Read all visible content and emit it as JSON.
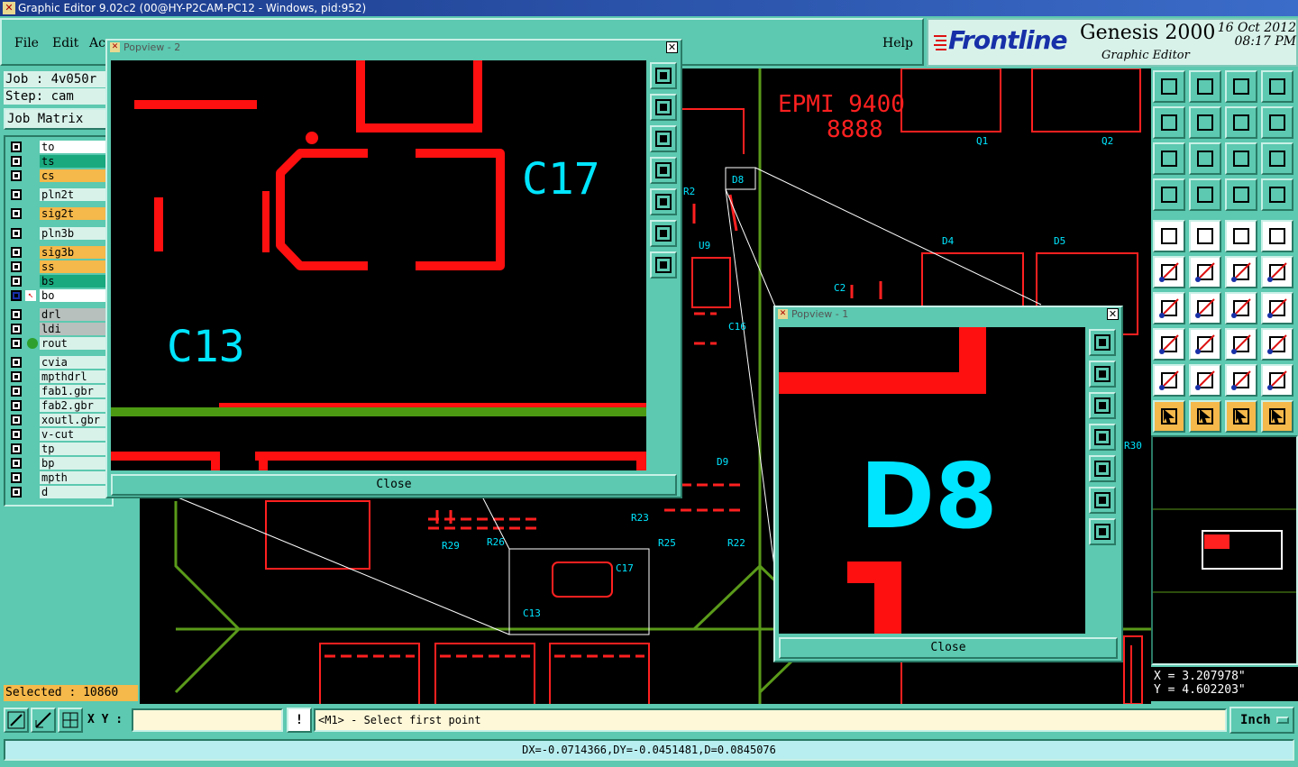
{
  "window": {
    "title": "Graphic Editor 9.02c2 (00@HY-P2CAM-PC12 - Windows, pid:952)"
  },
  "menu": {
    "file": "File",
    "edit": "Edit",
    "action": "Ac",
    "help": "Help"
  },
  "brand": {
    "logo": "Frontline",
    "product": "Genesis 2000",
    "module": "Graphic Editor",
    "date": "16 Oct 2012",
    "time": "08:17 PM"
  },
  "job": {
    "job": "Job : 4v050r",
    "step": "Step: cam",
    "matrix_button": "Job Matrix ..."
  },
  "layers": [
    {
      "name": "to",
      "color": "#ffffff"
    },
    {
      "name": "ts",
      "color": "#1aa97e"
    },
    {
      "name": "cs",
      "color": "#f5b84a"
    },
    {
      "name": "pln2t",
      "color": "#d8f2ea"
    },
    {
      "name": "sig2t",
      "color": "#f5b84a"
    },
    {
      "name": "pln3b",
      "color": "#d8f2ea"
    },
    {
      "name": "sig3b",
      "color": "#f5b84a"
    },
    {
      "name": "ss",
      "color": "#f5b84a"
    },
    {
      "name": "bs",
      "color": "#1aa97e"
    },
    {
      "name": "bo",
      "color": "#ffffff"
    },
    {
      "name": "drl",
      "color": "#b7c0bd"
    },
    {
      "name": "ldi",
      "color": "#b7c0bd"
    },
    {
      "name": "rout",
      "color": "#d8f2ea"
    },
    {
      "name": "cvia",
      "color": "#d8f2ea"
    },
    {
      "name": "mpthdrl",
      "color": "#d8f2ea"
    },
    {
      "name": "fab1.gbr",
      "color": "#d8f2ea"
    },
    {
      "name": "fab2.gbr",
      "color": "#d8f2ea"
    },
    {
      "name": "xoutl.gbr",
      "color": "#d8f2ea"
    },
    {
      "name": "v-cut",
      "color": "#d8f2ea"
    },
    {
      "name": "tp",
      "color": "#d8f2ea"
    },
    {
      "name": "bp",
      "color": "#d8f2ea"
    },
    {
      "name": "mpth",
      "color": "#d8f2ea"
    },
    {
      "name": "d",
      "color": "#d8f2ea"
    }
  ],
  "selected": "Selected : 10860",
  "canvas_labels": {
    "epmi": "EPMI 9400",
    "eights": "8888",
    "q1": "Q1",
    "q2": "Q2",
    "d8": "D8",
    "r2": "R2",
    "u9": "U9",
    "d4": "D4",
    "d5": "D5",
    "c2": "C2",
    "c16": "C16",
    "r30": "R30",
    "d9": "D9",
    "r23": "R23",
    "r25": "R25",
    "r22": "R22",
    "r29": "R29",
    "r26": "R26",
    "c17": "C17",
    "c13": "C13"
  },
  "popup2": {
    "title": "Popview - 2",
    "close": "Close",
    "label_c17": "C17",
    "label_c13": "C13"
  },
  "popup1": {
    "title": "Popview - 1",
    "close": "Close",
    "label_d8": "D8"
  },
  "coords": {
    "x": "X = 3.207978\"",
    "y": "Y = 4.602203\""
  },
  "command": {
    "xy_label": "X Y :",
    "xy_value": "",
    "prompt": "<M1> - Select first point",
    "unit": "Inch",
    "excl": "!"
  },
  "status": {
    "text": "DX=-0.0714366,DY=-0.0451481,D=0.0845076"
  },
  "colors": {
    "panel": "#5cc9b0",
    "highlight": "#f5b84a",
    "pad": "#ff0000",
    "silk": "#00e5ff",
    "outline": "#5a9a1a"
  }
}
